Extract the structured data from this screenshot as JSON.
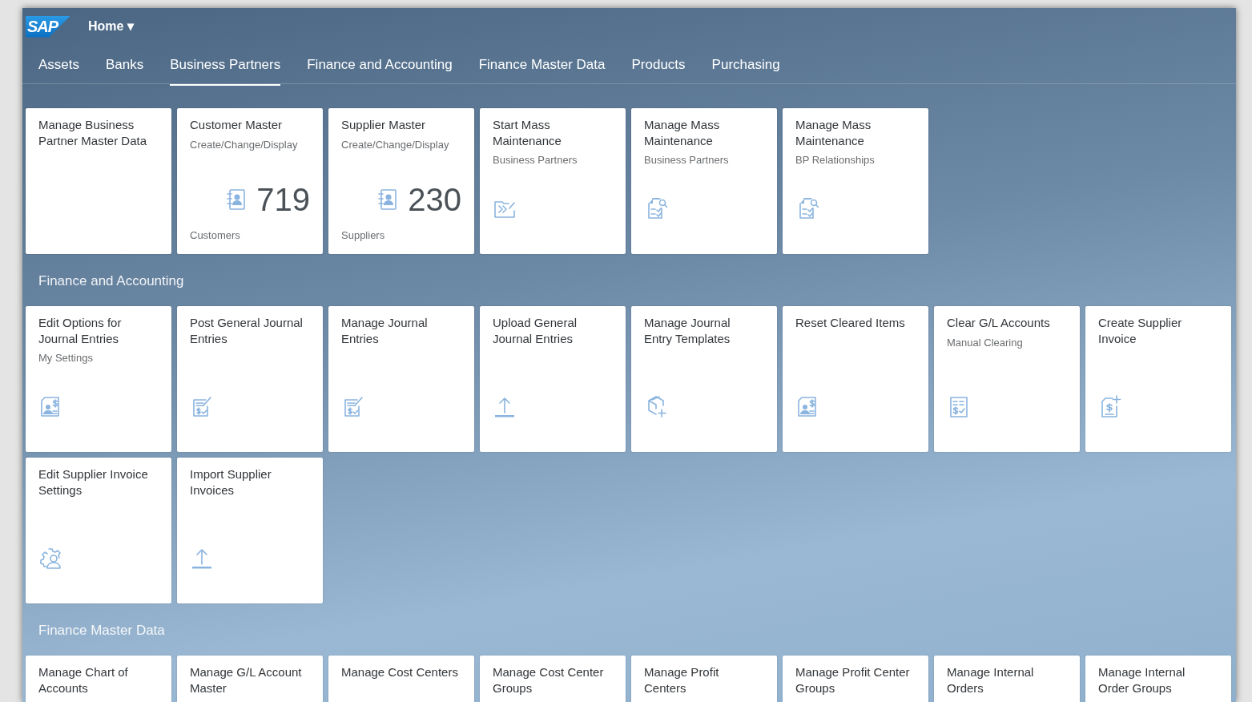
{
  "header": {
    "logo": "SAP",
    "menu": "Home ▾"
  },
  "tabs": [
    {
      "label": "Assets",
      "selected": false
    },
    {
      "label": "Banks",
      "selected": false
    },
    {
      "label": "Business Partners",
      "selected": true
    },
    {
      "label": "Finance and Accounting",
      "selected": false
    },
    {
      "label": "Finance Master Data",
      "selected": false
    },
    {
      "label": "Products",
      "selected": false
    },
    {
      "label": "Purchasing",
      "selected": false
    }
  ],
  "sections": [
    {
      "tiles": [
        {
          "kind": "app",
          "title": "Manage Business Partner Master Data"
        },
        {
          "kind": "kpi",
          "title": "Customer Master",
          "subtitle": "Create/Change/Display",
          "value": "719",
          "footer": "Customers"
        },
        {
          "kind": "kpi",
          "title": "Supplier Master",
          "subtitle": "Create/Change/Display",
          "value": "230",
          "footer": "Suppliers"
        },
        {
          "kind": "app",
          "title": "Start Mass Maintenance",
          "subtitle": "Business Partners"
        },
        {
          "kind": "app",
          "title": "Manage Mass Maintenance",
          "subtitle": "Business Partners"
        },
        {
          "kind": "app",
          "title": "Manage Mass Maintenance",
          "subtitle": "BP Relationships"
        }
      ]
    },
    {
      "title": "Finance and Accounting",
      "tiles": [
        {
          "kind": "app",
          "title": "Edit Options for Journal Entries",
          "subtitle": "My Settings"
        },
        {
          "kind": "app",
          "title": "Post General Journal Entries"
        },
        {
          "kind": "app",
          "title": "Manage Journal Entries"
        },
        {
          "kind": "app",
          "title": "Upload General Journal Entries"
        },
        {
          "kind": "app",
          "title": "Manage Journal Entry Templates"
        },
        {
          "kind": "app",
          "title": "Reset Cleared Items"
        },
        {
          "kind": "app",
          "title": "Clear G/L Accounts",
          "subtitle": "Manual Clearing"
        },
        {
          "kind": "app",
          "title": "Create Supplier Invoice"
        },
        {
          "kind": "app",
          "title": "Edit Supplier Invoice Settings"
        },
        {
          "kind": "app",
          "title": "Import Supplier Invoices"
        }
      ]
    },
    {
      "title": "Finance Master Data",
      "tiles": [
        {
          "kind": "app",
          "title": "Manage Chart of Accounts"
        },
        {
          "kind": "app",
          "title": "Manage G/L Account Master"
        },
        {
          "kind": "app",
          "title": "Manage Cost Centers"
        },
        {
          "kind": "app",
          "title": "Manage Cost Center Groups"
        },
        {
          "kind": "app",
          "title": "Manage Profit Centers"
        },
        {
          "kind": "app",
          "title": "Manage Profit Center Groups"
        },
        {
          "kind": "app",
          "title": "Manage Internal Orders"
        },
        {
          "kind": "app",
          "title": "Manage Internal Order Groups"
        }
      ]
    }
  ]
}
